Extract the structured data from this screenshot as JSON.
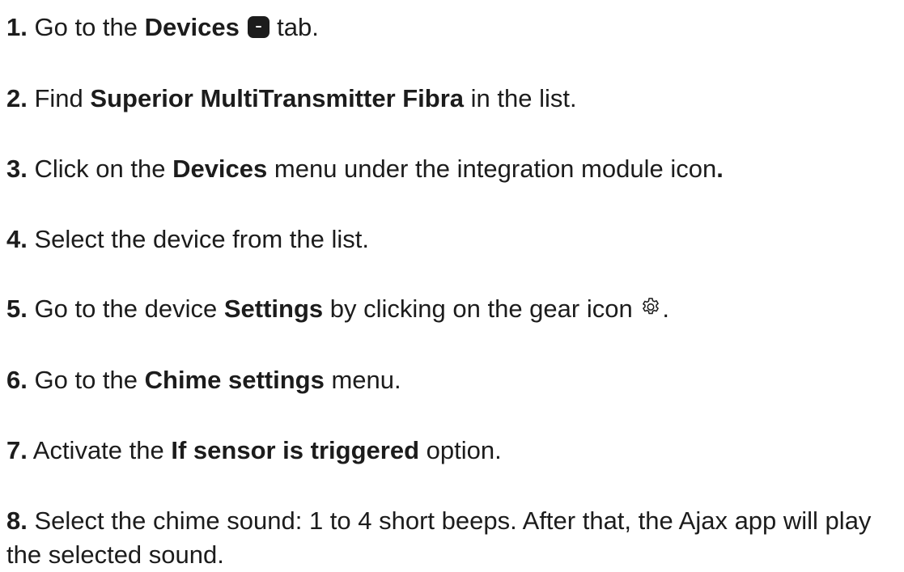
{
  "steps": [
    {
      "num": "1.",
      "parts": [
        "Go to the ",
        "Devices",
        "tab."
      ]
    },
    {
      "num": "2.",
      "parts": [
        "Find ",
        "Superior MultiTransmitter Fibra",
        " in the list."
      ]
    },
    {
      "num": "3.",
      "parts": [
        "Click on the ",
        "Devices",
        " menu under the integration module icon",
        "."
      ]
    },
    {
      "num": "4.",
      "parts": [
        "Select the device from the list."
      ]
    },
    {
      "num": "5.",
      "parts": [
        "Go to the device ",
        "Settings",
        " by clicking on the gear icon ",
        "."
      ]
    },
    {
      "num": "6.",
      "parts": [
        "Go to the ",
        "Chime settings",
        " menu."
      ]
    },
    {
      "num": "7.",
      "parts": [
        "Activate the ",
        "If sensor is triggered",
        " option."
      ]
    },
    {
      "num": "8.",
      "parts": [
        "Select the chime sound: 1 to 4 short beeps. After that, the Ajax app will play the selected sound."
      ]
    }
  ],
  "icons": {
    "devices_tab": "devices-tab-icon",
    "gear": "gear-icon"
  }
}
